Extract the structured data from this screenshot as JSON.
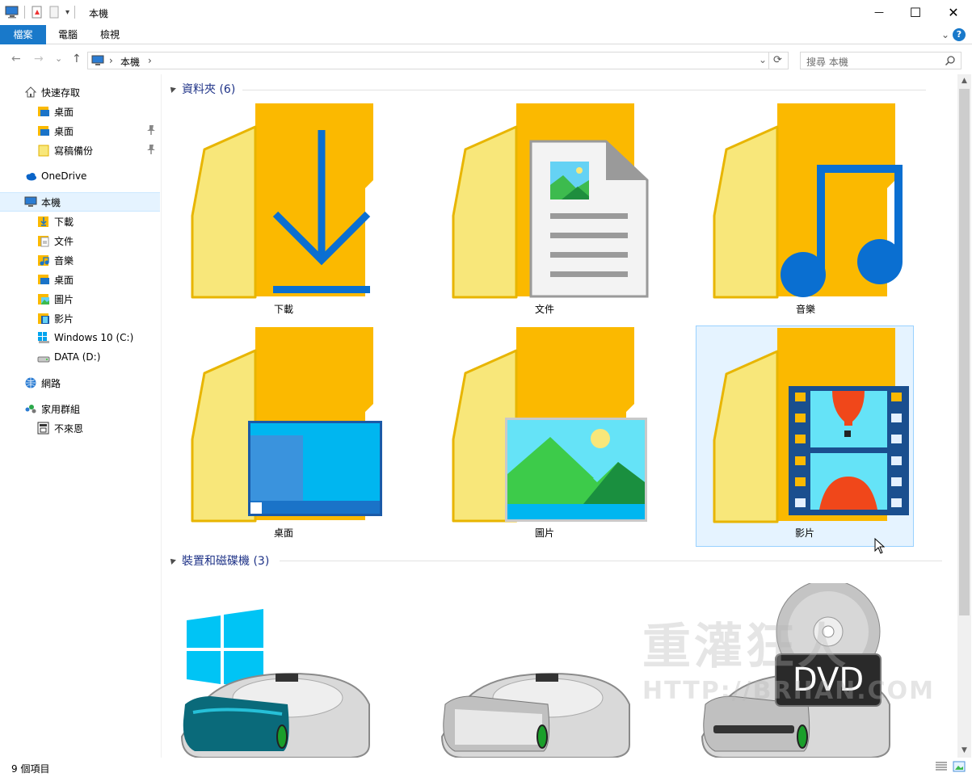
{
  "window": {
    "title": "本機",
    "minimize_icon": "—",
    "maximize_icon": "☐",
    "close_icon": "✕"
  },
  "ribbon": {
    "tabs": [
      "檔案",
      "電腦",
      "檢視"
    ],
    "expand_glyph": "⌄",
    "help_glyph": "?"
  },
  "nav": {
    "back": "←",
    "forward": "→",
    "recent": "⌄",
    "up": "↑",
    "breadcrumb": [
      "本機"
    ],
    "breadcrumb_sep": "›",
    "dropdown_glyph": "⌄",
    "refresh_glyph": "⟳"
  },
  "search": {
    "placeholder": "搜尋 本機"
  },
  "sidebar": {
    "items": [
      {
        "label": "快速存取",
        "icon": "star-home-icon",
        "level": 0
      },
      {
        "label": "桌面",
        "icon": "desktop-folder-icon",
        "level": 1
      },
      {
        "label": "桌面",
        "icon": "desktop-folder-icon",
        "level": 1,
        "pinned": true
      },
      {
        "label": "寫稿備份",
        "icon": "folder-icon",
        "level": 1,
        "pinned": true
      },
      {
        "label": "OneDrive",
        "icon": "onedrive-icon",
        "level": 0
      },
      {
        "label": "本機",
        "icon": "computer-icon",
        "level": 0,
        "selected": true
      },
      {
        "label": "下載",
        "icon": "downloads-icon",
        "level": 1
      },
      {
        "label": "文件",
        "icon": "documents-icon",
        "level": 1
      },
      {
        "label": "音樂",
        "icon": "music-icon",
        "level": 1
      },
      {
        "label": "桌面",
        "icon": "desktop-folder-icon",
        "level": 1
      },
      {
        "label": "圖片",
        "icon": "pictures-icon",
        "level": 1
      },
      {
        "label": "影片",
        "icon": "videos-icon",
        "level": 1
      },
      {
        "label": "Windows 10 (C:)",
        "icon": "windows-drive-icon",
        "level": 1
      },
      {
        "label": "DATA (D:)",
        "icon": "drive-icon",
        "level": 1
      },
      {
        "label": "網路",
        "icon": "network-icon",
        "level": 0
      },
      {
        "label": "家用群組",
        "icon": "homegroup-icon",
        "level": 0
      },
      {
        "label": "不來恩",
        "icon": "user-icon",
        "level": 1
      }
    ]
  },
  "groups": [
    {
      "title": "資料夾 (6)"
    },
    {
      "title": "裝置和磁碟機 (3)"
    }
  ],
  "folders": [
    {
      "label": "下載",
      "overlay": "download-arrow-icon"
    },
    {
      "label": "文件",
      "overlay": "document-page-icon"
    },
    {
      "label": "音樂",
      "overlay": "music-note-icon"
    },
    {
      "label": "桌面",
      "overlay": "desktop-screen-icon"
    },
    {
      "label": "圖片",
      "overlay": "landscape-picture-icon"
    },
    {
      "label": "影片",
      "overlay": "film-strip-icon",
      "selected": true
    }
  ],
  "drives": [
    {
      "name": "windows-system-drive-icon"
    },
    {
      "name": "hard-drive-icon"
    },
    {
      "name": "dvd-drive-icon",
      "badge": "DVD"
    }
  ],
  "status": {
    "count": "9 個項目"
  },
  "colors": {
    "accent": "#1979ca",
    "folder_front": "#f8e77a",
    "folder_back": "#fbb900",
    "selection": "#e5f3ff",
    "selection_border": "#99d1ff",
    "group_title": "#1e3287"
  }
}
